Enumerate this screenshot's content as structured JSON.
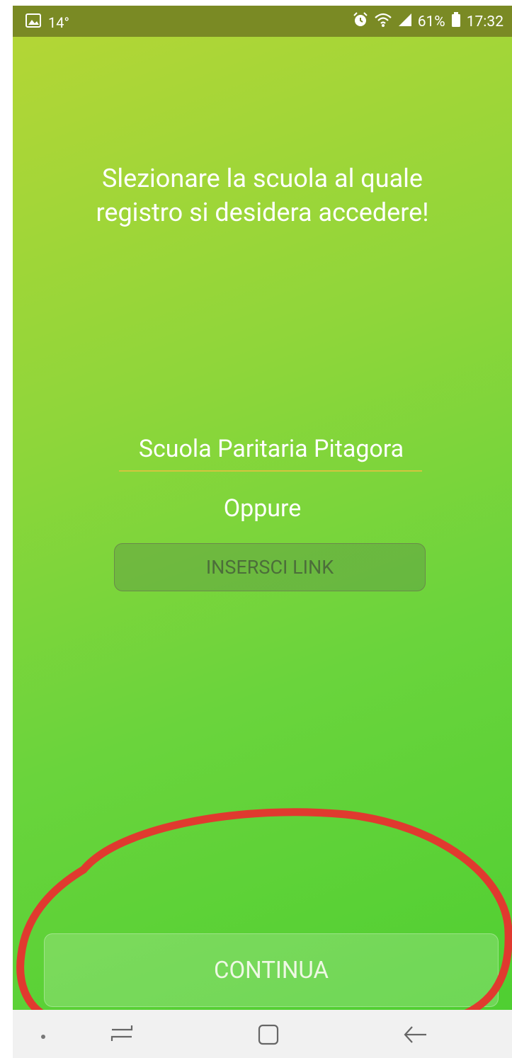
{
  "status_bar": {
    "temperature": "14°",
    "battery_percent": "61%",
    "time": "17:32",
    "bar_color": "#7a8a24"
  },
  "main": {
    "headline": "Slezionare la scuola al quale\nregistro si desidera accedere!",
    "school_value": "Scuola Paritaria Pitagora",
    "or_label": "Oppure",
    "link_button_label": "INSERSCI LINK",
    "continue_button_label": "CONTINUA"
  },
  "navigation_bar": {
    "icons": [
      "dot-icon",
      "recent-apps-icon",
      "home-icon",
      "back-icon"
    ]
  },
  "colors": {
    "gradient_top": "#b3d636",
    "gradient_bottom": "#4fcf32",
    "annotation_red": "#e03a2f"
  }
}
